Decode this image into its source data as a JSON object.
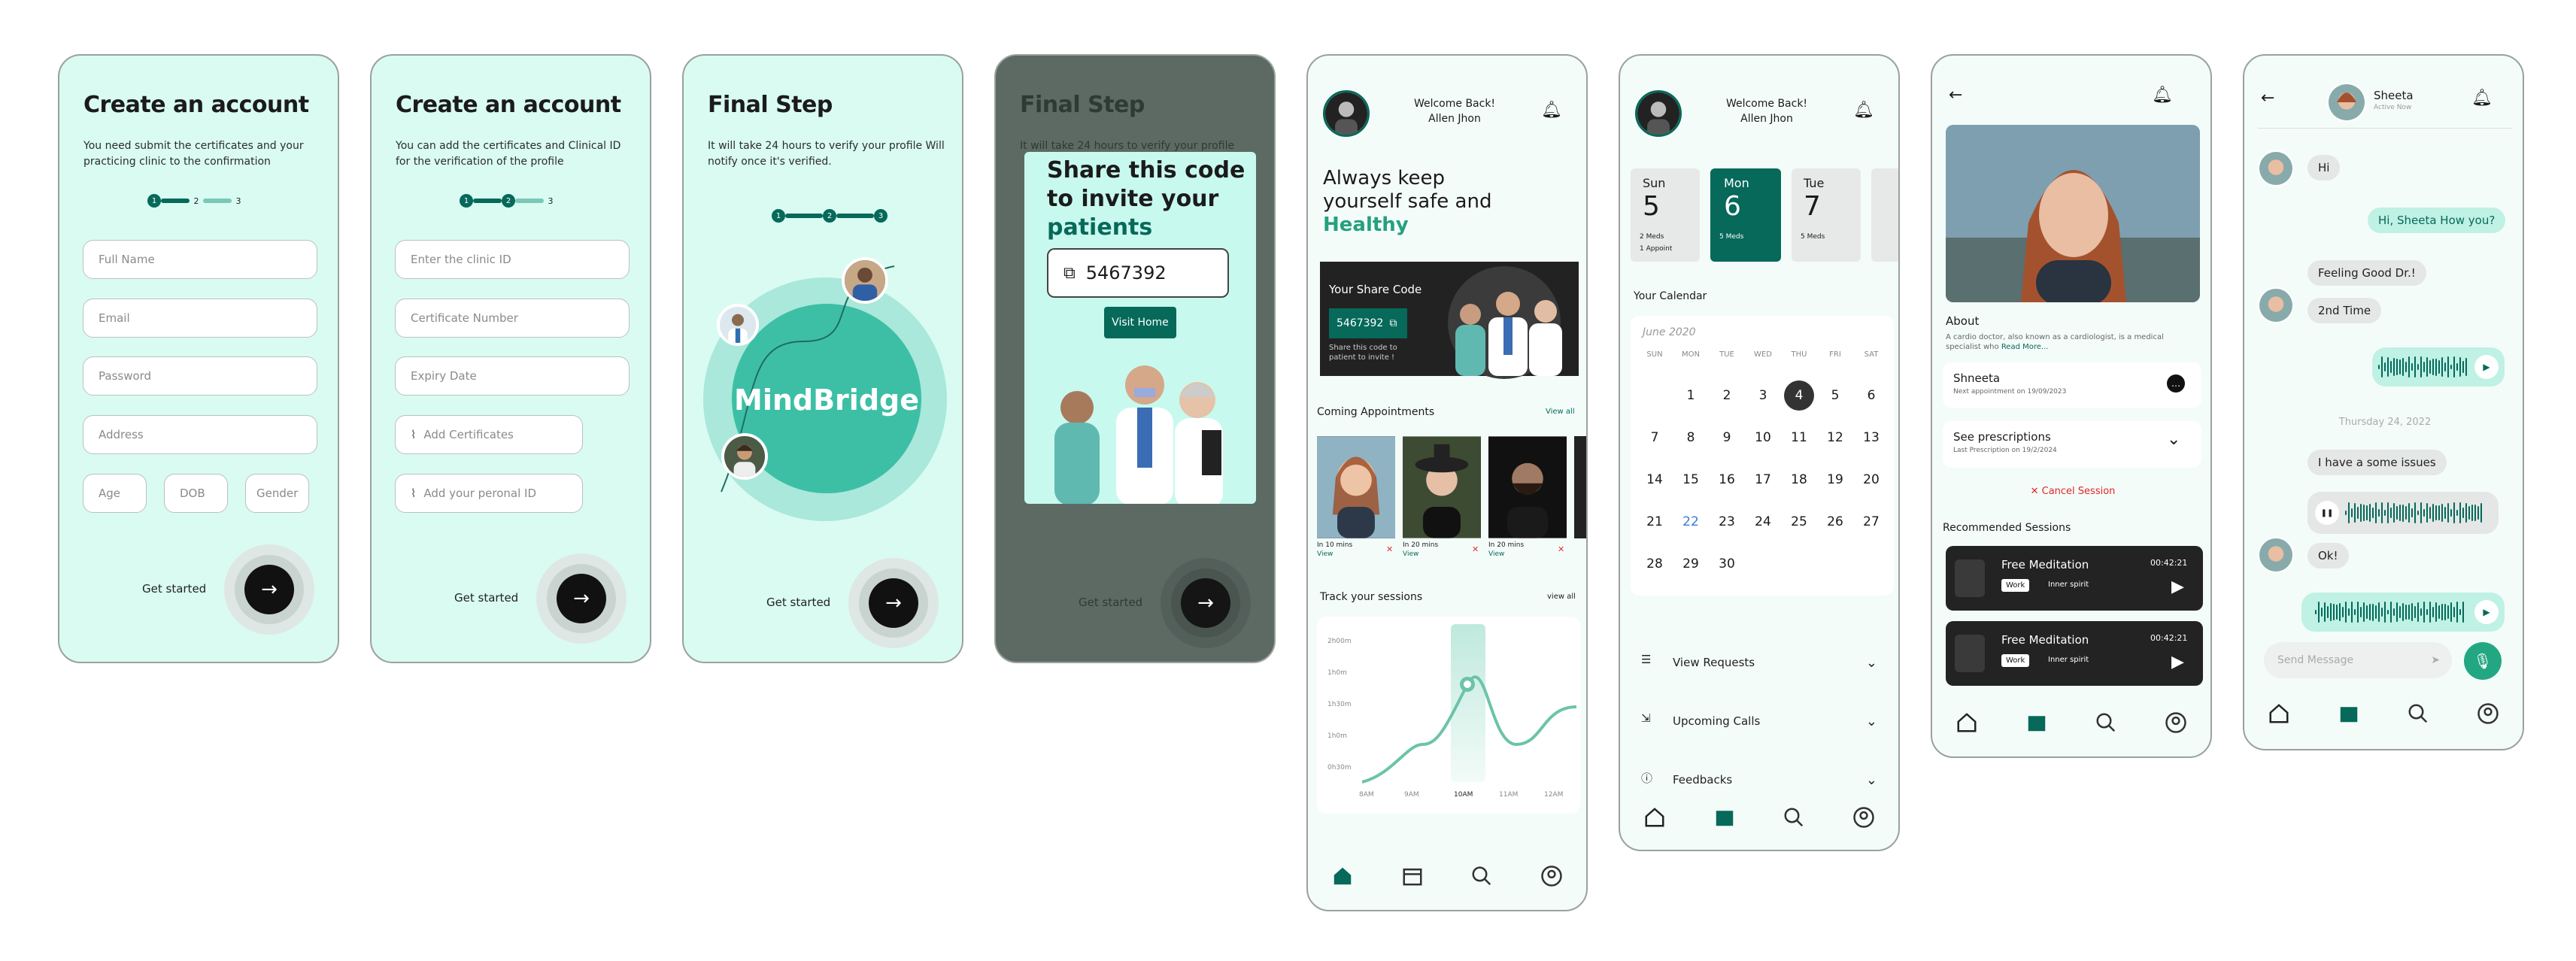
{
  "colors": {
    "primary": "#06695a",
    "mint": "#d9fbf2",
    "dark": "#111111"
  },
  "s1": {
    "title": "Create an account",
    "sub": "You need submit the certificates and your practicing clinic to the confirmation",
    "steps": [
      "1",
      "2",
      "3"
    ],
    "fields": [
      "Full Name",
      "Email",
      "Password",
      "Address"
    ],
    "small": [
      "Age",
      "DOB",
      "Gender"
    ],
    "cta": "Get started"
  },
  "s2": {
    "title": "Create an account",
    "sub": "You can add the certificates and Clinical ID for the verification of the profile",
    "steps": [
      "1",
      "2",
      "3"
    ],
    "fields": [
      "Enter the clinic ID",
      "Certificate Number",
      "Expiry Date"
    ],
    "attach": [
      "Add Certificates",
      "Add your peronal ID"
    ],
    "cta": "Get started"
  },
  "s3": {
    "title": "Final Step",
    "sub": "It will take 24 hours to verify your profile Will notify once it's verified.",
    "steps": [
      "1",
      "2",
      "3"
    ],
    "brand": "MindBridge",
    "cta": "Get started"
  },
  "s4": {
    "title": "Final Step",
    "sub": "It will take 24 hours to verify your profile",
    "share1": "Share this code",
    "share2": "to invite your",
    "share3": "patients",
    "code": "5467392",
    "visit": "Visit Home",
    "cta": "Get started"
  },
  "s5": {
    "welcome": "Welcome Back!",
    "name": "Allen Jhon",
    "head1": "Always keep",
    "head2": "yourself safe and",
    "head3": "Healthy",
    "sharecode": "Your Share Code",
    "code": "5467392",
    "sharenote": "Share this code to patient to invite !",
    "coming": "Coming Appointments",
    "viewall": "View all",
    "appts": [
      {
        "t": "In 10 mins",
        "v": "View"
      },
      {
        "t": "In 20 mins",
        "v": "View"
      },
      {
        "t": "In 20 mins",
        "v": "View"
      }
    ],
    "track": "Track your sessions",
    "viewall2": "view all",
    "yticks": [
      "2h00m",
      "1h0m",
      "1h30m",
      "1h0m",
      "0h30m"
    ],
    "xticks": [
      "8AM",
      "9AM",
      "10AM",
      "11AM",
      "12AM"
    ]
  },
  "s6": {
    "welcome": "Welcome Back!",
    "name": "Allen Jhon",
    "days": [
      {
        "d": "Sun",
        "n": "5",
        "a": "2 Meds",
        "b": "1 Appoint"
      },
      {
        "d": "Mon",
        "n": "6",
        "a": "5 Meds",
        "b": ""
      },
      {
        "d": "Tue",
        "n": "7",
        "a": "5 Meds",
        "b": ""
      }
    ],
    "cal_title": "Your Calendar",
    "month": "June 2020",
    "dow": [
      "SUN",
      "MON",
      "TUE",
      "WED",
      "THU",
      "FRI",
      "SAT"
    ],
    "dates": [
      "",
      "1",
      "2",
      "3",
      "4",
      "5",
      "6",
      "7",
      "8",
      "9",
      "10",
      "11",
      "12",
      "13",
      "14",
      "15",
      "16",
      "17",
      "18",
      "19",
      "20",
      "21",
      "22",
      "23",
      "24",
      "25",
      "26",
      "27",
      "28",
      "29",
      "30"
    ],
    "menu": [
      "View Requests",
      "Upcoming Calls",
      "Feedbacks"
    ]
  },
  "s7": {
    "about": "About",
    "about_text": "A cardio doctor, also known as a cardiologist, is a medical specialist who",
    "readmore": "Read More...",
    "pname": "Shneeta",
    "pnext": "Next appointment on 19/09/2023",
    "presc": "See prescriptions",
    "presc_sub": "Last Prescription on 19/2/2024",
    "cancel": "Cancel Session",
    "rec": "Recommended Sessions",
    "sessions": [
      {
        "t": "Free Meditation",
        "tag": "Work",
        "s": "Inner spirit",
        "time": "00:42:21"
      },
      {
        "t": "Free Meditation",
        "tag": "Work",
        "s": "Inner spirit",
        "time": "00:42:21"
      }
    ]
  },
  "s8": {
    "name": "Sheeta",
    "status": "Active Now",
    "m1": "Hi",
    "m2": "Hi, Sheeta How you?",
    "m3": "Feeling Good Dr.!",
    "m4": "2nd Time",
    "date": "Thursday 24, 2022",
    "m5": "I have a some issues",
    "m6": "Ok!",
    "placeholder": "Send Message"
  }
}
